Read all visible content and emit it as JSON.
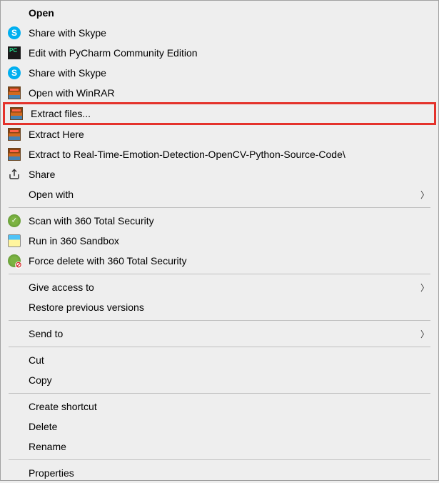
{
  "menu": {
    "open": "Open",
    "share_skype_1": "Share with Skype",
    "edit_pycharm": "Edit with PyCharm Community Edition",
    "share_skype_2": "Share with Skype",
    "open_winrar": "Open with WinRAR",
    "extract_files": "Extract files...",
    "extract_here": "Extract Here",
    "extract_to": "Extract to Real-Time-Emotion-Detection-OpenCV-Python-Source-Code\\",
    "share": "Share",
    "open_with": "Open with",
    "scan_360": "Scan with 360 Total Security",
    "run_sandbox": "Run in 360 Sandbox",
    "force_delete": "Force delete with 360 Total Security",
    "give_access": "Give access to",
    "restore_versions": "Restore previous versions",
    "send_to": "Send to",
    "cut": "Cut",
    "copy": "Copy",
    "create_shortcut": "Create shortcut",
    "delete": "Delete",
    "rename": "Rename",
    "properties": "Properties"
  }
}
